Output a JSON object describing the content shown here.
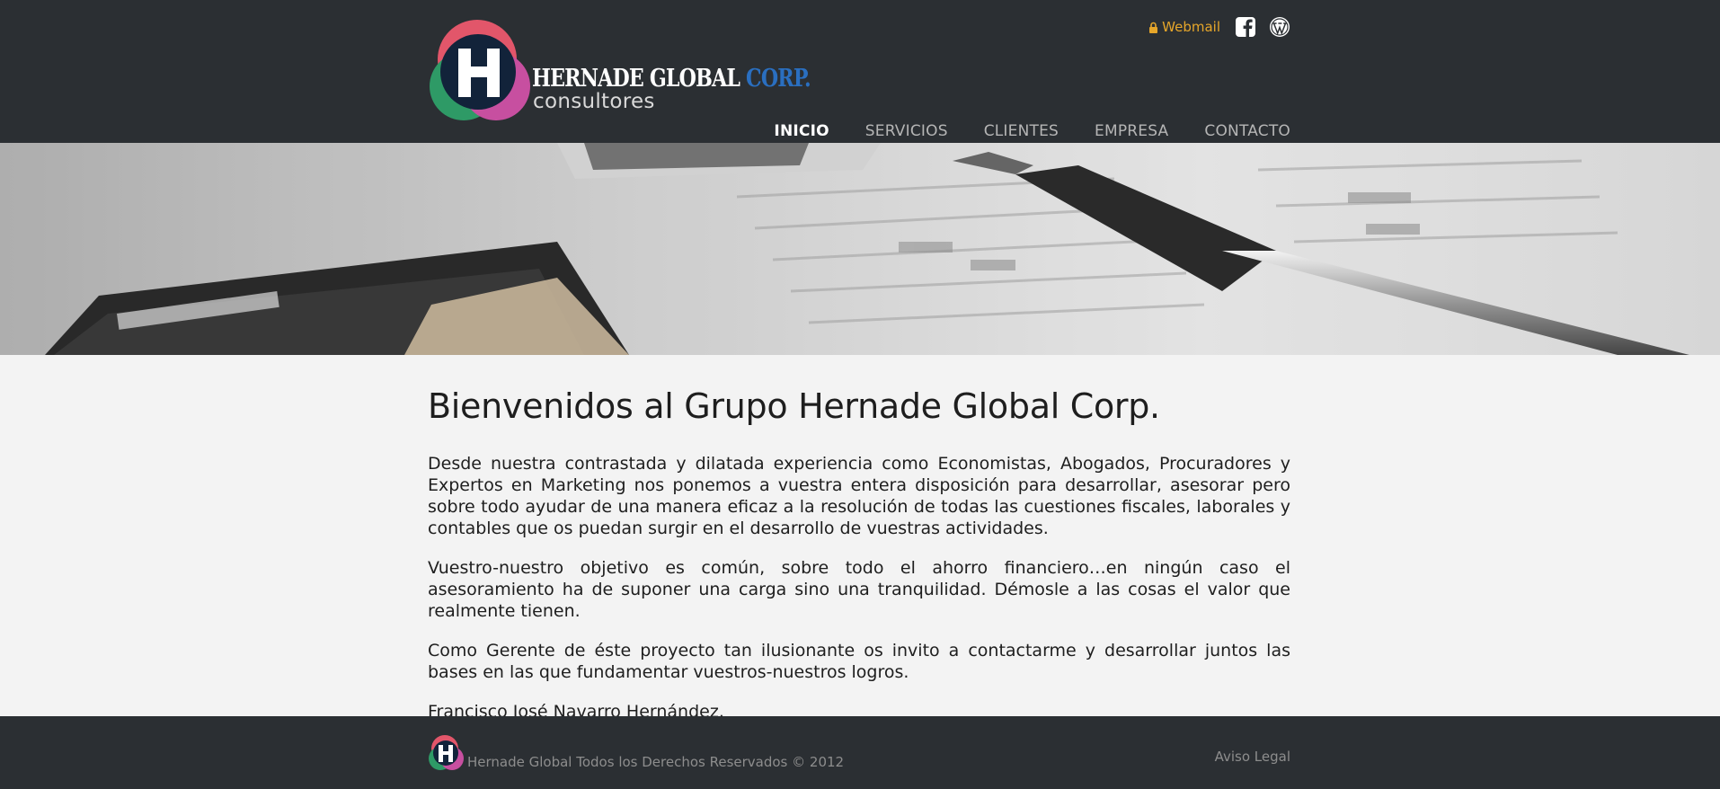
{
  "header": {
    "logo_title": "HERNADE GLOBAL ",
    "logo_title_accent": "CORP.",
    "logo_subtitle": "consultores",
    "webmail_label": "Webmail",
    "social_icons": [
      "facebook-icon",
      "wordpress-icon"
    ]
  },
  "nav": {
    "items": [
      {
        "label": "INICIO",
        "active": true
      },
      {
        "label": "SERVICIOS"
      },
      {
        "label": "CLIENTES"
      },
      {
        "label": "EMPRESA"
      },
      {
        "label": "CONTACTO"
      }
    ]
  },
  "main": {
    "title": "Bienvenidos al Grupo Hernade Global Corp.",
    "paragraphs": [
      "Desde nuestra contrastada y dilatada experiencia como Economistas, Abogados, Procuradores y Expertos en Marketing nos ponemos a vuestra entera disposición para desarrollar, asesorar pero sobre todo ayudar de una manera eficaz a la resolución de todas las cuestiones fiscales, laborales y contables que os puedan surgir en el desarrollo de vuestras actividades.",
      "Vuestro-nuestro objetivo es común, sobre todo el ahorro financiero…en ningún caso el asesoramiento ha de suponer una carga sino una tranquilidad. Démosle a las cosas el valor que realmente tienen.",
      "Como Gerente de éste proyecto tan ilusionante os invito a contactarme y desarrollar juntos las bases en las que fundamentar vuestros-nuestros logros.",
      "Francisco José Navarro Hernández."
    ]
  },
  "footer": {
    "copyright": "Hernade Global Todos los Derechos Reservados © 2012",
    "legal_link": "Aviso Legal"
  },
  "colors": {
    "header_bg": "#2b2f33",
    "accent_orange": "#e6a62a",
    "accent_blue": "#2a6fc0",
    "page_bg": "#f3f3f3"
  }
}
